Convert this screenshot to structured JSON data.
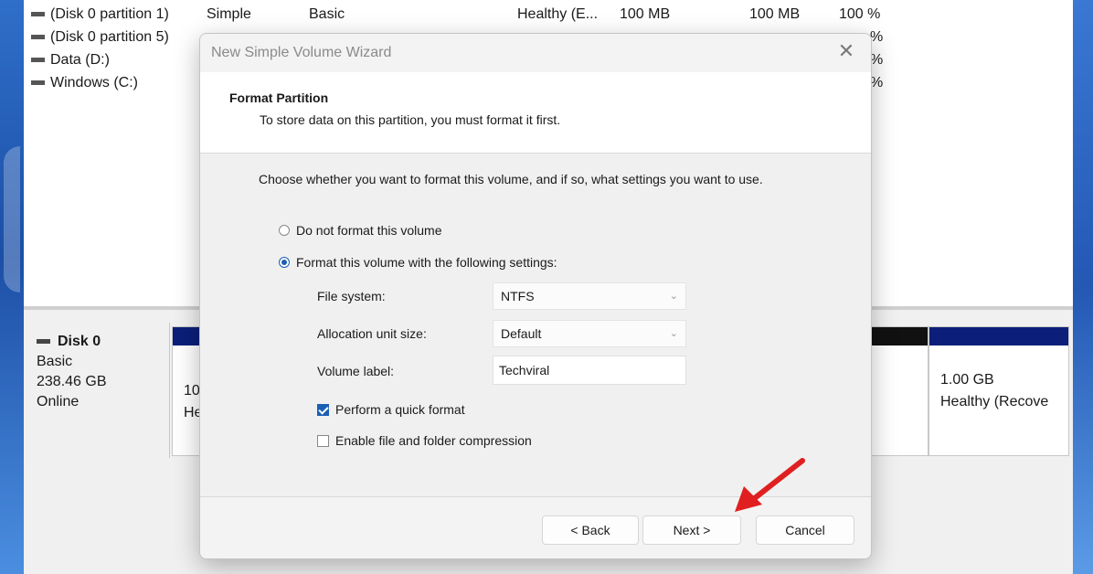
{
  "volumes": [
    {
      "name": "(Disk 0 partition 1)",
      "layout": "Simple",
      "type": "Basic",
      "status": "Healthy (E...",
      "capacity": "100 MB",
      "free": "100 MB",
      "pct": "100 %"
    },
    {
      "name": "(Disk 0 partition 5)",
      "layout": "",
      "type": "",
      "status": "",
      "capacity": "",
      "free": "",
      "pct": "%"
    },
    {
      "name": "Data (D:)",
      "layout": "",
      "type": "",
      "status": "",
      "capacity": "",
      "free": "",
      "pct": "%"
    },
    {
      "name": "Windows (C:)",
      "layout": "",
      "type": "",
      "status": "",
      "capacity": "",
      "free": "",
      "pct": "%"
    }
  ],
  "disk": {
    "title": "Disk 0",
    "type": "Basic",
    "size": "238.46 GB",
    "state": "Online"
  },
  "partitions": {
    "first_line1": "10",
    "first_line2": "He",
    "recovery_size": "1.00 GB",
    "recovery_status": "Healthy (Recove"
  },
  "wizard": {
    "title": "New Simple Volume Wizard",
    "close": "✕",
    "header_title": "Format Partition",
    "header_subtitle": "To store data on this partition, you must format it first.",
    "intro": "Choose whether you want to format this volume, and if so, what settings you want to use.",
    "option_no_format": "Do not format this volume",
    "option_format": "Format this volume with the following settings:",
    "file_system_label": "File system:",
    "file_system_value": "NTFS",
    "alloc_label": "Allocation unit size:",
    "alloc_value": "Default",
    "volume_label_label": "Volume label:",
    "volume_label_value": "Techviral",
    "quick_format_label": "Perform a quick format",
    "quick_format_checked": true,
    "compression_label": "Enable file and folder compression",
    "compression_checked": false,
    "back_button": "< Back",
    "next_button": "Next >",
    "cancel_button": "Cancel"
  },
  "colors": {
    "partition_bar": "#0b1f7a",
    "accent": "#1a5fb4",
    "arrow": "#e02020"
  }
}
